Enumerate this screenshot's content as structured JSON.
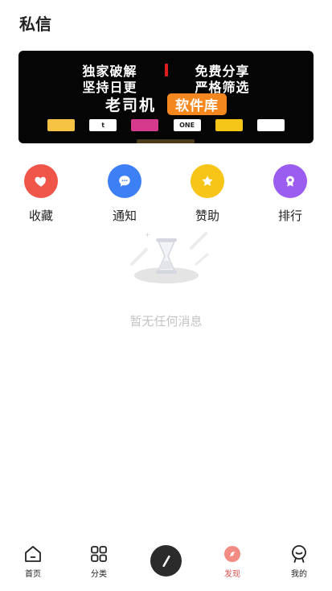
{
  "header": {
    "title": "私信"
  },
  "banner": {
    "line1_left": "独家破解",
    "line1_right": "免费分享",
    "line2_left": "坚持日更",
    "line2_right": "严格筛选",
    "brand": "老司机",
    "tag": "软件库",
    "apps": [
      {
        "name": "app-1-icon",
        "label": "",
        "bg": "#f6c244",
        "fg": "#b32"
      },
      {
        "name": "app-2-icon",
        "label": "t",
        "bg": "#ffffff",
        "fg": "#222"
      },
      {
        "name": "app-3-icon",
        "label": "",
        "bg": "#d63a8c",
        "fg": "#fff"
      },
      {
        "name": "app-4-icon",
        "label": "ONE",
        "bg": "#ffffff",
        "fg": "#222"
      },
      {
        "name": "app-5-icon",
        "label": "",
        "bg": "#f5c518",
        "fg": "#222"
      },
      {
        "name": "app-6-icon",
        "label": "",
        "bg": "#ffffff",
        "fg": "#e0457b"
      }
    ]
  },
  "quick_actions": [
    {
      "label": "收藏",
      "icon": "heart-icon",
      "color": "#f0554a"
    },
    {
      "label": "通知",
      "icon": "chat-bubble-icon",
      "color": "#3d7ff5"
    },
    {
      "label": "赞助",
      "icon": "star-icon",
      "color": "#f7c418"
    },
    {
      "label": "排行",
      "icon": "trophy-icon",
      "color": "#9b5cf0"
    }
  ],
  "empty_state": {
    "text": "暂无任何消息",
    "icon": "hourglass-icon"
  },
  "tabbar": {
    "items": [
      {
        "label": "首页",
        "icon": "home-icon",
        "active": false
      },
      {
        "label": "分类",
        "icon": "grid-icon",
        "active": false
      },
      {
        "label": "",
        "icon": "pencil-icon",
        "active": false
      },
      {
        "label": "发现",
        "icon": "compass-icon",
        "active": true
      },
      {
        "label": "我的",
        "icon": "user-smile-icon",
        "active": false
      }
    ]
  },
  "colors": {
    "accent": "#d9534f",
    "text": "#222222",
    "muted": "#c4c4c4"
  }
}
